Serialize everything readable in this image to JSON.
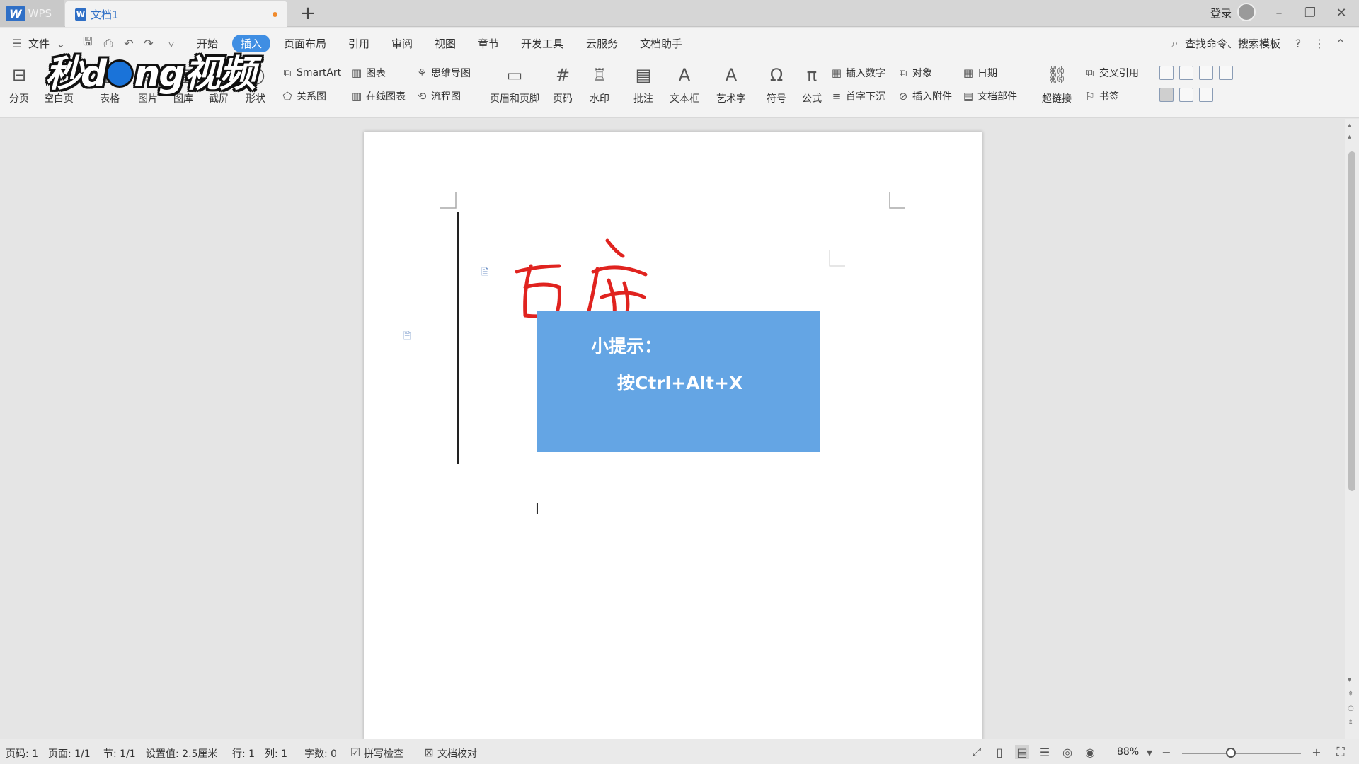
{
  "titlebar": {
    "app_name": "WPS",
    "doc_tab": "文档1",
    "new_tab": "+",
    "login": "登录",
    "minimize": "–",
    "restore": "❐",
    "close": "✕"
  },
  "menu": {
    "file": "文件",
    "tabs": [
      "开始",
      "插入",
      "页面布局",
      "引用",
      "审阅",
      "视图",
      "章节",
      "开发工具",
      "云服务",
      "文档助手"
    ],
    "active_tab": "插入",
    "search": "查找命令、搜索模板"
  },
  "ribbon": {
    "page_break": "分页",
    "blank_page": "空白页",
    "table": "表格",
    "picture": "图片",
    "gallery": "图库",
    "screenshot": "截屏",
    "shape": "形状",
    "smartart": "SmartArt",
    "chart": "图表",
    "mindmap": "思维导图",
    "relation": "关系图",
    "online_chart": "在线图表",
    "flowchart": "流程图",
    "header_footer": "页眉和页脚",
    "page_number": "页码",
    "watermark": "水印",
    "comment": "批注",
    "textbox": "文本框",
    "wordart": "艺术字",
    "symbol": "符号",
    "formula": "公式",
    "insert_number": "插入数字",
    "object": "对象",
    "date": "日期",
    "dropcap": "首字下沉",
    "attachment": "插入附件",
    "doc_parts": "文档部件",
    "hyperlink": "超链接",
    "cross_ref": "交叉引用",
    "bookmark": "书签"
  },
  "watermark_logo": {
    "text_left": "秒d",
    "text_right": "ng视频"
  },
  "document": {
    "handwriting_color": "#e0231f",
    "tip_title": "小提示：",
    "tip_body": "按Ctrl+Alt+X",
    "tip_bg": "#64a5e4"
  },
  "statusbar": {
    "page_num": "页码: 1",
    "pages": "页面: 1/1",
    "section": "节: 1/1",
    "setting": "设置值: 2.5厘米",
    "row": "行: 1",
    "col": "列: 1",
    "word_count": "字数: 0",
    "spell_check": "拼写检查",
    "doc_proof": "文档校对",
    "zoom": "88%",
    "zoom_minus": "−",
    "zoom_plus": "+"
  }
}
